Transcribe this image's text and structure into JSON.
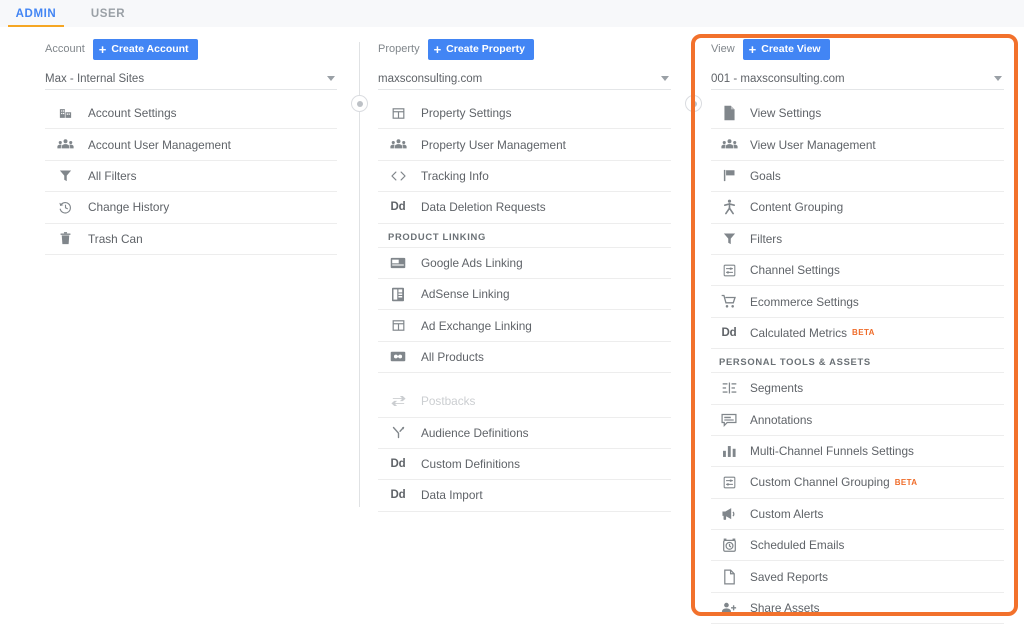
{
  "header": {
    "tabs": [
      {
        "label": "ADMIN",
        "active": true
      },
      {
        "label": "USER",
        "active": false
      }
    ]
  },
  "colors": {
    "accent_blue": "#4285f4",
    "highlight_orange": "#f2712c",
    "tab_underline": "#f5a623",
    "beta_badge": "#ef6c2a",
    "text": "#5f6368",
    "header_bg": "#f7f8fa"
  },
  "columns": {
    "account": {
      "label": "Account",
      "create_label": "Create Account",
      "create_icon": "plus-icon",
      "selected": "Max - Internal Sites",
      "dropdown_icon": "chevron-down-icon",
      "items": [
        {
          "label": "Account Settings",
          "icon": "building-icon"
        },
        {
          "label": "Account User Management",
          "icon": "people-icon"
        },
        {
          "label": "All Filters",
          "icon": "funnel-icon"
        },
        {
          "label": "Change History",
          "icon": "history-icon"
        },
        {
          "label": "Trash Can",
          "icon": "trash-icon"
        }
      ]
    },
    "property": {
      "label": "Property",
      "create_label": "Create Property",
      "create_icon": "plus-icon",
      "selected": "maxsconsulting.com",
      "dropdown_icon": "chevron-down-icon",
      "items": [
        {
          "label": "Property Settings",
          "icon": "window-icon"
        },
        {
          "label": "Property User Management",
          "icon": "people-icon"
        },
        {
          "label": "Tracking Info",
          "icon": "code-brackets-icon"
        },
        {
          "label": "Data Deletion Requests",
          "icon": "dd-icon"
        }
      ],
      "section_product_linking": "PRODUCT LINKING",
      "product_linking_items": [
        {
          "label": "Google Ads Linking",
          "icon": "google-ads-icon"
        },
        {
          "label": "AdSense Linking",
          "icon": "adsense-icon"
        },
        {
          "label": "Ad Exchange Linking",
          "icon": "ad-exchange-icon"
        },
        {
          "label": "All Products",
          "icon": "all-products-icon"
        }
      ],
      "extra_items": [
        {
          "label": "Postbacks",
          "icon": "postbacks-icon",
          "dimmed": true
        },
        {
          "label": "Audience Definitions",
          "icon": "audience-icon"
        },
        {
          "label": "Custom Definitions",
          "icon": "dd-icon"
        },
        {
          "label": "Data Import",
          "icon": "dd-icon"
        }
      ]
    },
    "view": {
      "label": "View",
      "create_label": "Create View",
      "create_icon": "plus-icon",
      "selected": "001 - maxsconsulting.com",
      "dropdown_icon": "chevron-down-icon",
      "highlighted": true,
      "items": [
        {
          "label": "View Settings",
          "icon": "document-icon"
        },
        {
          "label": "View User Management",
          "icon": "people-icon"
        },
        {
          "label": "Goals",
          "icon": "flag-icon"
        },
        {
          "label": "Content Grouping",
          "icon": "content-grouping-icon"
        },
        {
          "label": "Filters",
          "icon": "funnel-icon"
        },
        {
          "label": "Channel Settings",
          "icon": "channel-settings-icon"
        },
        {
          "label": "Ecommerce Settings",
          "icon": "cart-icon"
        },
        {
          "label": "Calculated Metrics",
          "icon": "dd-icon",
          "badge": "BETA"
        }
      ],
      "section_personal_tools": "PERSONAL TOOLS & ASSETS",
      "personal_tools_items": [
        {
          "label": "Segments",
          "icon": "segments-icon"
        },
        {
          "label": "Annotations",
          "icon": "annotation-icon"
        },
        {
          "label": "Multi-Channel Funnels Settings",
          "icon": "bar-chart-icon"
        },
        {
          "label": "Custom Channel Grouping",
          "icon": "channel-settings-icon",
          "badge": "BETA"
        },
        {
          "label": "Custom Alerts",
          "icon": "megaphone-icon"
        },
        {
          "label": "Scheduled Emails",
          "icon": "alarm-clock-icon"
        },
        {
          "label": "Saved Reports",
          "icon": "page-icon"
        },
        {
          "label": "Share Assets",
          "icon": "person-add-icon"
        }
      ]
    }
  }
}
